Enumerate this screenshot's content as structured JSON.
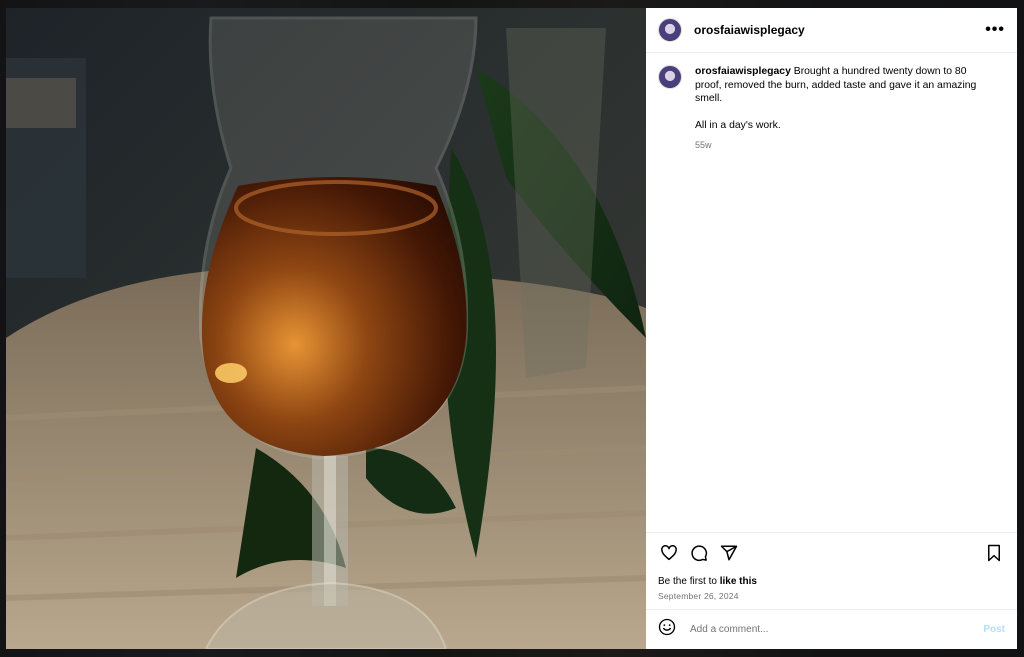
{
  "post": {
    "username": "orosfaiawisplegacy",
    "more_label": "•••",
    "caption": {
      "username": "orosfaiawisplegacy",
      "text": "Brought a hundred twenty down to 80 proof, removed the burn, added taste and gave it an amazing smell.\n\nAll in a day's work.",
      "time": "55w"
    },
    "likes_prefix": "Be the first to ",
    "likes_link": "like this",
    "date": "September 26, 2024",
    "comment_placeholder": "Add a comment...",
    "post_label": "Post"
  },
  "icons": [
    "heart-icon",
    "comment-icon",
    "share-icon",
    "bookmark-icon",
    "emoji-icon",
    "more-icon"
  ],
  "colors": {
    "post_button": "#b2dffc",
    "muted_text": "#737373"
  }
}
